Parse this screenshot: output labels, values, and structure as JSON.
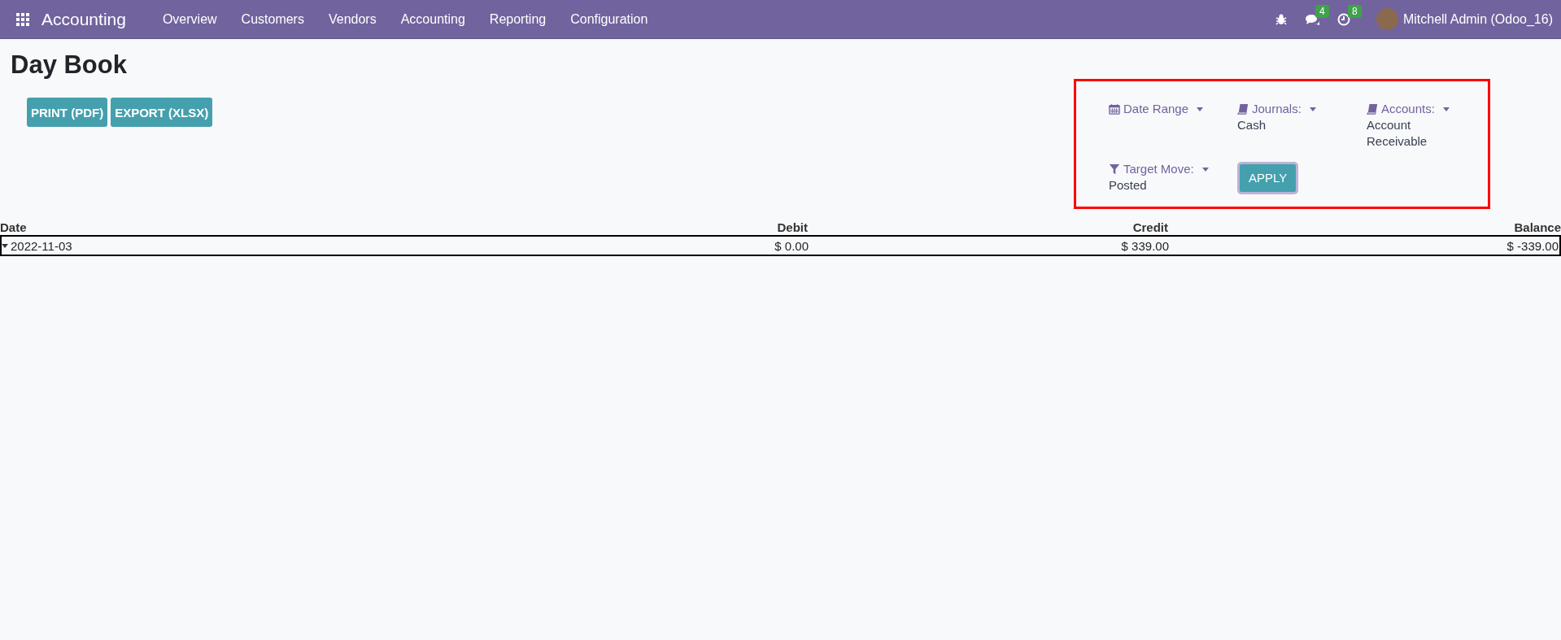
{
  "navbar": {
    "app_name": "Accounting",
    "menu": [
      "Overview",
      "Customers",
      "Vendors",
      "Accounting",
      "Reporting",
      "Configuration"
    ],
    "messages_count": "4",
    "activities_count": "8",
    "user_name": "Mitchell Admin (Odoo_16)"
  },
  "title": "Day Book",
  "buttons": [
    "PRINT (PDF)",
    "EXPORT (XLSX)"
  ],
  "filters": [
    {
      "kind": "calendar",
      "label": "Date Range"
    },
    {
      "kind": "book",
      "label": "Journals:",
      "values": [
        "Cash"
      ]
    },
    {
      "kind": "book",
      "label": "Accounts:",
      "values": [
        "Account",
        "Receivable"
      ]
    },
    {
      "kind": "funnel",
      "label": "Target Move:",
      "values": [
        "Posted"
      ]
    }
  ],
  "apply_button": "APPLY",
  "table": {
    "columns": [
      "Date",
      "Debit",
      "Credit",
      "Balance"
    ],
    "rows": [
      {
        "expanded": true,
        "cells": [
          "2022-11-03",
          "$ 0.00",
          "$ 339.00",
          "$ -339.00"
        ]
      }
    ]
  }
}
